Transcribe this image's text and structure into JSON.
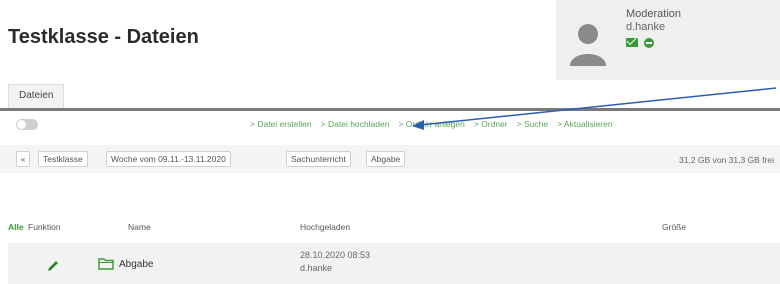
{
  "page": {
    "title": "Testklasse - Dateien"
  },
  "moderation": {
    "title": "Moderation",
    "user": "d.hanke",
    "icons": [
      "mail-icon",
      "remove-icon"
    ]
  },
  "tabs": [
    {
      "label": "Dateien",
      "active": true
    }
  ],
  "toolbar": {
    "actions": [
      "> Datei erstellen",
      "> Datei hochladen",
      "> Ordner anlegen",
      "> Ordner",
      "> Suche",
      "> Aktualisieren"
    ]
  },
  "breadcrumb": {
    "items": [
      "Testklasse",
      "Woche vom 09.11.-13.11.2020",
      "Sachunterricht",
      "Abgabe"
    ],
    "storage": "31,2 GB von 31,3 GB frei"
  },
  "table": {
    "headers": {
      "all": "Alle",
      "function": "Funktion",
      "name": "Name",
      "uploaded": "Hochgeladen",
      "size": "Größe"
    },
    "rows": [
      {
        "name": "Abgabe",
        "uploaded_date": "28.10.2020 08:53",
        "uploaded_by": "d.hanke",
        "icon": "folder-icon"
      }
    ]
  },
  "colors": {
    "accent": "#3a9a3a",
    "arrow": "#2a5fb0"
  }
}
